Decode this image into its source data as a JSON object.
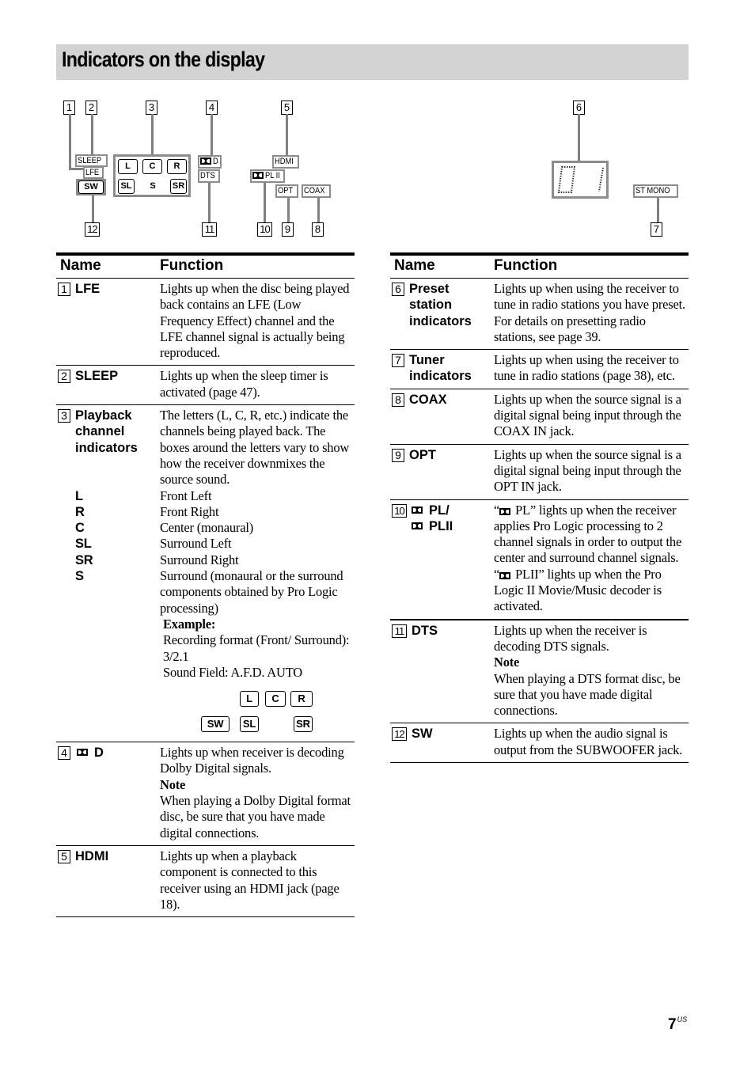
{
  "page": {
    "title": "Indicators on the display",
    "page_number": "7",
    "page_suffix": "US"
  },
  "diagram": {
    "callouts": [
      "1",
      "2",
      "3",
      "4",
      "5",
      "6",
      "7",
      "8",
      "9",
      "10",
      "11",
      "12"
    ],
    "indicators": {
      "sleep": "SLEEP",
      "lfe": "LFE",
      "sw": "SW",
      "channels_top": [
        "L",
        "C",
        "R"
      ],
      "channels_bottom": [
        "SL",
        "S",
        "SR"
      ],
      "dolby_d": "D",
      "dts": "DTS",
      "hdmi": "HDMI",
      "pl2": "PL II",
      "opt": "OPT",
      "coax": "COAX",
      "st_mono": "ST MONO",
      "preset_display": "01",
      "dolby_icon": "dolby-double-d-icon"
    }
  },
  "tables": {
    "header_name": "Name",
    "header_function": "Function",
    "left": [
      {
        "num": "1",
        "name": "LFE",
        "function": "Lights up when the disc being played back contains an LFE (Low Frequency Effect) channel and the LFE channel signal is actually being reproduced."
      },
      {
        "num": "2",
        "name": "SLEEP",
        "function": "Lights up when the sleep timer is activated (page 47)."
      },
      {
        "num": "3",
        "name": "Playback\nchannel\nindicators",
        "function": "The letters (L, C, R, etc.) indicate the channels being played back. The boxes around the letters vary to show how the receiver downmixes the source sound.",
        "channels": [
          {
            "key": "L",
            "value": "Front Left"
          },
          {
            "key": "R",
            "value": "Front Right"
          },
          {
            "key": "C",
            "value": "Center (monaural)"
          },
          {
            "key": "SL",
            "value": "Surround Left"
          },
          {
            "key": "SR",
            "value": "Surround Right"
          },
          {
            "key": "S",
            "value": "Surround (monaural or the surround components obtained by Pro Logic processing)"
          }
        ],
        "example_label": "Example:",
        "example_lines": [
          "Recording format (Front/ Surround): 3/2.1",
          "Sound Field: A.F.D. AUTO"
        ],
        "example_boxes_top": [
          "L",
          "C",
          "R"
        ],
        "example_boxes_bottom": [
          "SW",
          "SL",
          "SR"
        ]
      },
      {
        "num": "4",
        "name": "D",
        "function": "Lights up when receiver is decoding Dolby Digital signals.",
        "note_label": "Note",
        "note": "When playing a Dolby Digital format disc, be sure that you have made digital connections."
      },
      {
        "num": "5",
        "name": "HDMI",
        "function": "Lights up when a playback component is connected to this receiver using an HDMI jack (page 18)."
      }
    ],
    "right": [
      {
        "num": "6",
        "name": "Preset\nstation\nindicators",
        "function": "Lights up when using the receiver to tune in radio stations you have preset. For details on presetting radio stations, see page 39."
      },
      {
        "num": "7",
        "name": "Tuner\nindicators",
        "function": "Lights up when using the receiver to tune in radio stations (page 38), etc."
      },
      {
        "num": "8",
        "name": "COAX",
        "function": "Lights up when the source signal is a digital signal being input through the COAX IN jack."
      },
      {
        "num": "9",
        "name": "OPT",
        "function": "Lights up when the source signal is a digital signal being input through the OPT IN jack."
      },
      {
        "num": "10",
        "name_line1": "PL/",
        "name_line2": "PLII",
        "function_part1_prefix": "“",
        "function_part1_suffix": " PL” lights up when the receiver applies Pro Logic processing to 2 channel signals in order to output the center and surround channel signals.",
        "function_part2_prefix": "“",
        "function_part2_suffix": " PLII” lights up when the Pro Logic II Movie/Music decoder is activated."
      },
      {
        "num": "11",
        "name": "DTS",
        "function": "Lights up when the receiver is decoding DTS signals.",
        "note_label": "Note",
        "note": "When playing a DTS format disc, be sure that you have made digital connections."
      },
      {
        "num": "12",
        "name": "SW",
        "function": "Lights up when the audio signal is output from the SUBWOOFER jack."
      }
    ]
  }
}
